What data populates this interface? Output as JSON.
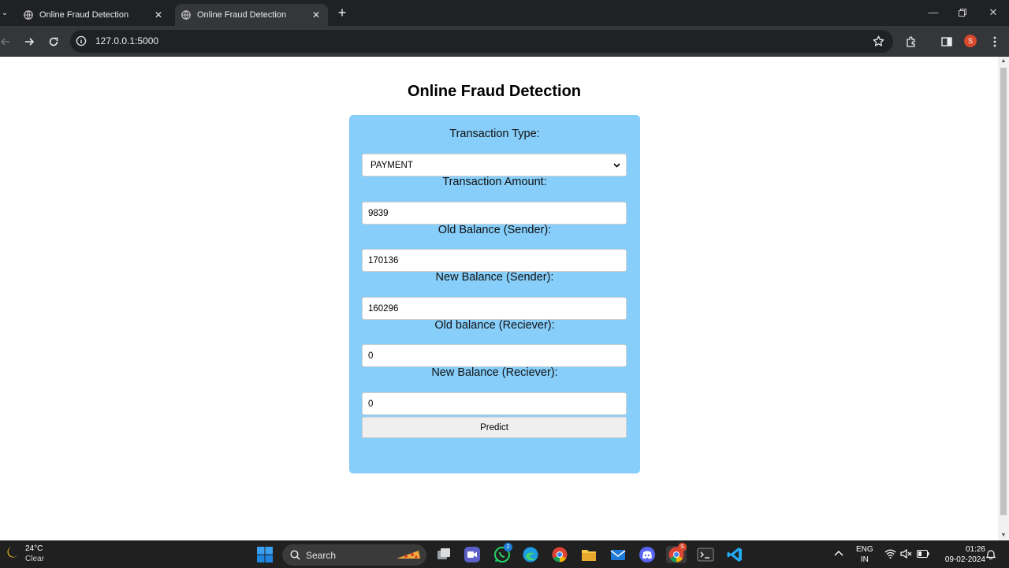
{
  "browser": {
    "tabs": [
      {
        "title": "Online Fraud Detection",
        "active": false
      },
      {
        "title": "Online Fraud Detection",
        "active": true
      }
    ],
    "address": "127.0.0.1:5000",
    "profile_initial": "S"
  },
  "page": {
    "title": "Online Fraud Detection",
    "form": {
      "transaction_type_label": "Transaction Type:",
      "transaction_type_value": "PAYMENT",
      "amount_label": "Transaction Amount:",
      "amount_value": "9839",
      "old_balance_sender_label": "Old Balance (Sender):",
      "old_balance_sender_value": "170136",
      "new_balance_sender_label": "New Balance (Sender):",
      "new_balance_sender_value": "160296",
      "old_balance_receiver_label": "Old balance (Reciever):",
      "old_balance_receiver_value": "0",
      "new_balance_receiver_label": "New Balance (Reciever):",
      "new_balance_receiver_value": "0",
      "submit_label": "Predict"
    },
    "card_color": "#87cefa"
  },
  "taskbar": {
    "weather_temp": "24°C",
    "weather_desc": "Clear",
    "search_label": "Search",
    "whatsapp_badge": "2",
    "chrome_badge": "S",
    "language_line1": "ENG",
    "language_line2": "IN",
    "time": "01:26",
    "date": "09-02-2024"
  }
}
